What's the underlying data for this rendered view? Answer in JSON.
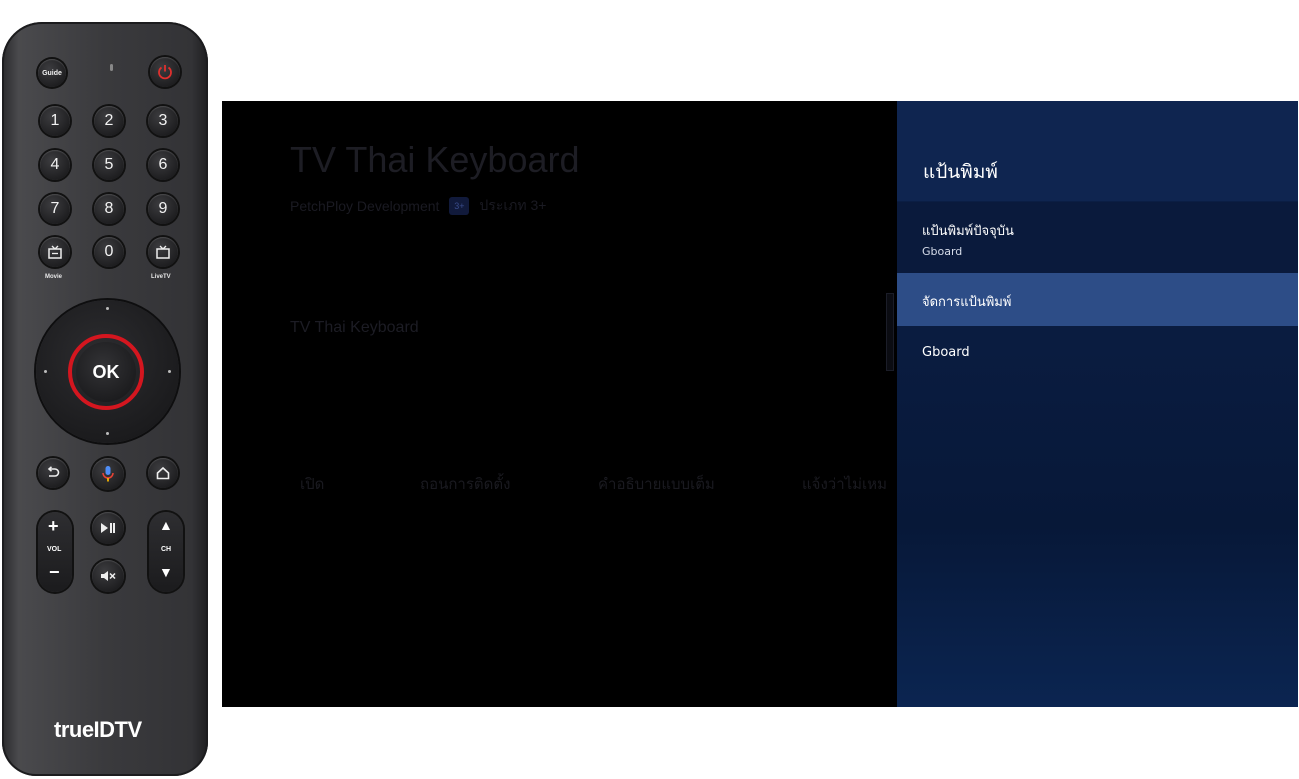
{
  "remote": {
    "guide_label": "Guide",
    "digits": [
      "1",
      "2",
      "3",
      "4",
      "5",
      "6",
      "7",
      "8",
      "9",
      "0"
    ],
    "movie_label": "Movie",
    "livetv_label": "LiveTV",
    "ok_label": "OK",
    "vol_label": "VOL",
    "ch_label": "CH",
    "vol_plus": "+",
    "vol_minus": "−",
    "ch_up": "▲",
    "ch_down": "▼",
    "brand": "trueIDTV",
    "ok_ring_color": "#d4161f"
  },
  "app": {
    "title": "TV Thai Keyboard",
    "developer": "PetchPloy Development",
    "rating_badge": "3+",
    "rating_text": "ประเภท 3+",
    "section_name": "TV Thai Keyboard",
    "actions": [
      "เปิด",
      "ถอนการติดตั้ง",
      "คำอธิบายแบบเต็ม",
      "แจ้งว่าไม่เหม"
    ]
  },
  "panel": {
    "title": "แป้นพิมพ์",
    "current_keyboard_label": "แป้นพิมพ์ปัจจุบัน",
    "current_keyboard_value": "Gboard",
    "manage_label": "จัดการแป้นพิมพ์",
    "gboard_label": "Gboard",
    "highlight_color": "#2d4d87"
  }
}
